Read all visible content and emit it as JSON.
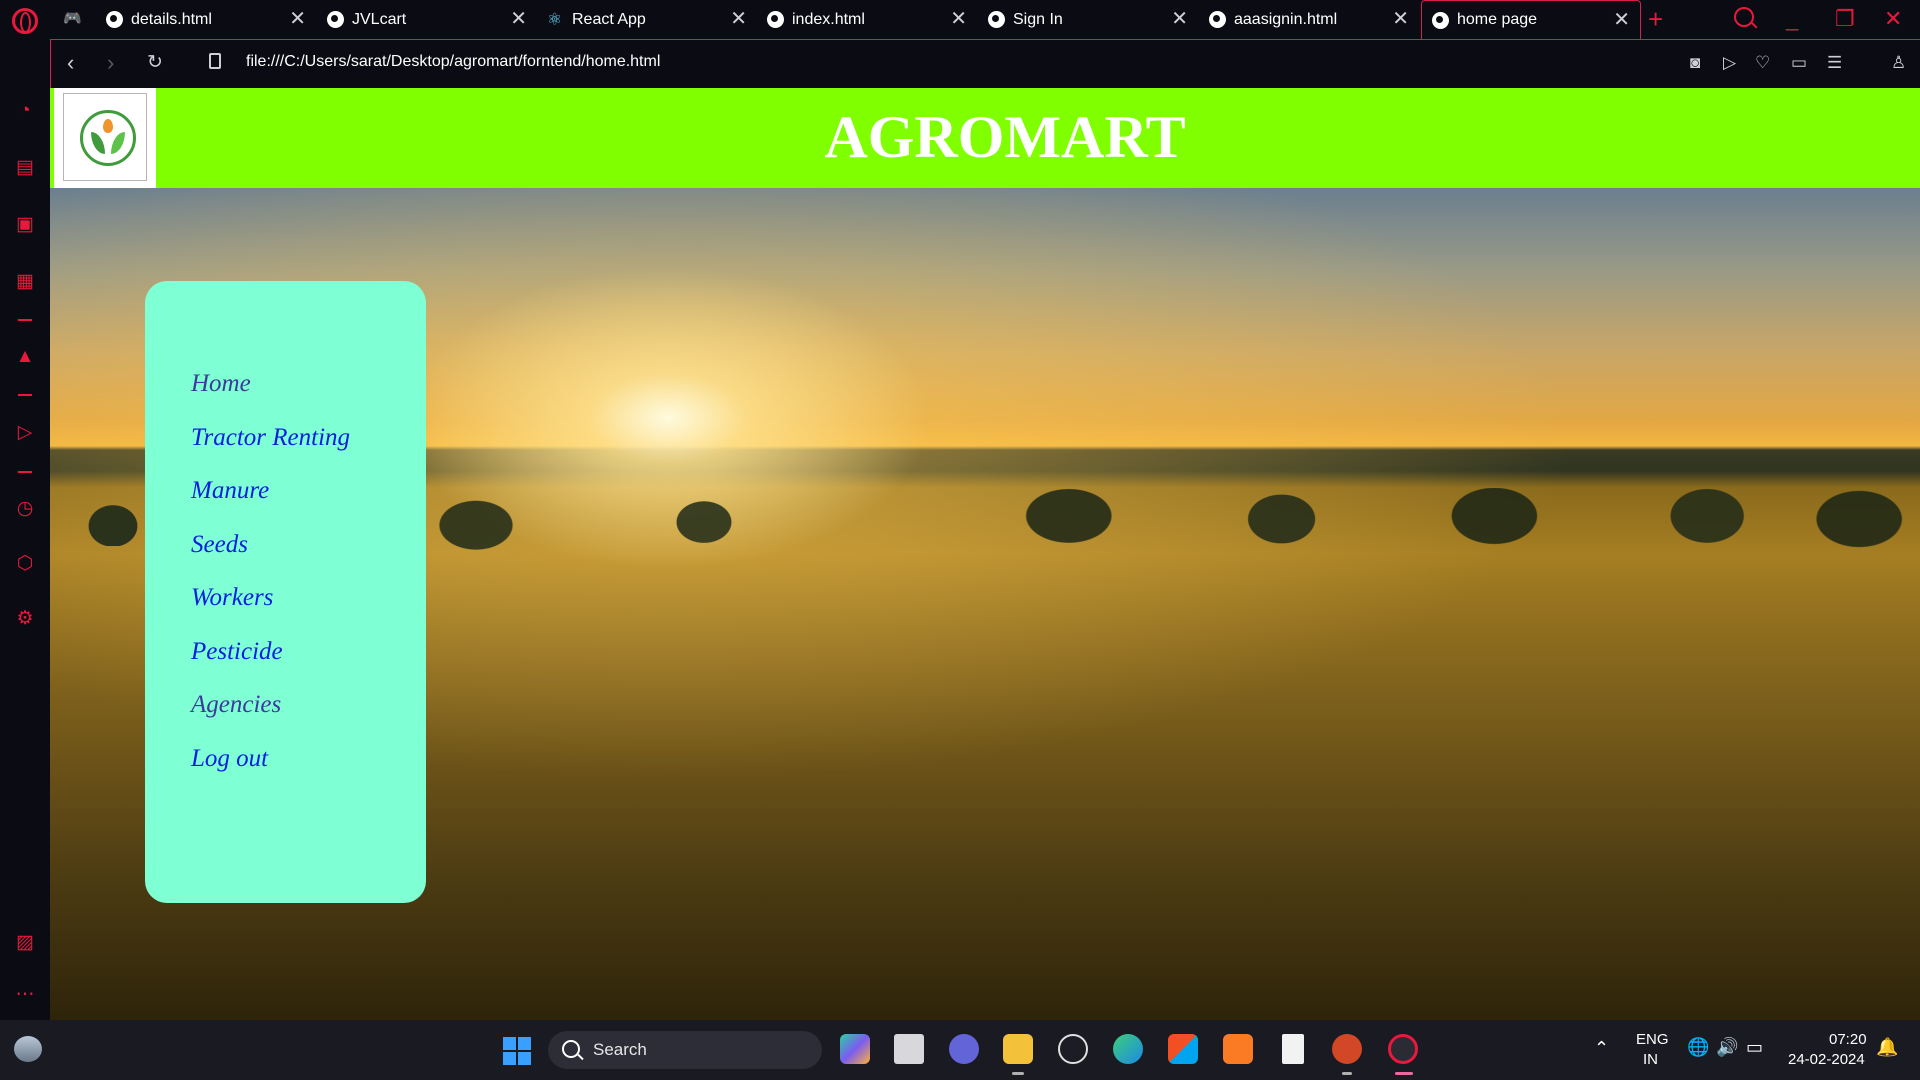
{
  "browser": {
    "tabs": [
      {
        "title": "details.html",
        "icon": "globe-icon"
      },
      {
        "title": "JVLcart",
        "icon": "globe-icon"
      },
      {
        "title": "React App",
        "icon": "react-icon"
      },
      {
        "title": "index.html",
        "icon": "globe-icon"
      },
      {
        "title": "Sign In",
        "icon": "globe-icon"
      },
      {
        "title": "aaasignin.html",
        "icon": "globe-icon"
      },
      {
        "title": "home page",
        "icon": "globe-icon",
        "active": true
      }
    ],
    "url": "file:///C:/Users/sarat/Desktop/agromart/forntend/home.html",
    "accent_color": "#e8193c"
  },
  "site": {
    "title": "AGROMART",
    "header_color": "#80ff00",
    "menu_color": "#7fffd4",
    "menu": [
      {
        "label": "Home",
        "color": "#3b3b9a"
      },
      {
        "label": "Tractor Renting",
        "color": "#0a1ee0"
      },
      {
        "label": "Manure",
        "color": "#0a1ee0"
      },
      {
        "label": "Seeds",
        "color": "#0a1ee0"
      },
      {
        "label": "Workers",
        "color": "#0a1ee0"
      },
      {
        "label": "Pesticide",
        "color": "#0a1ee0"
      },
      {
        "label": "Agencies",
        "color": "#3b3b9a"
      },
      {
        "label": "Log out",
        "color": "#0a1ee0"
      }
    ]
  },
  "taskbar": {
    "search_label": "Search",
    "lang_top": "ENG",
    "lang_bottom": "IN",
    "time": "07:20",
    "date": "24-02-2024"
  }
}
